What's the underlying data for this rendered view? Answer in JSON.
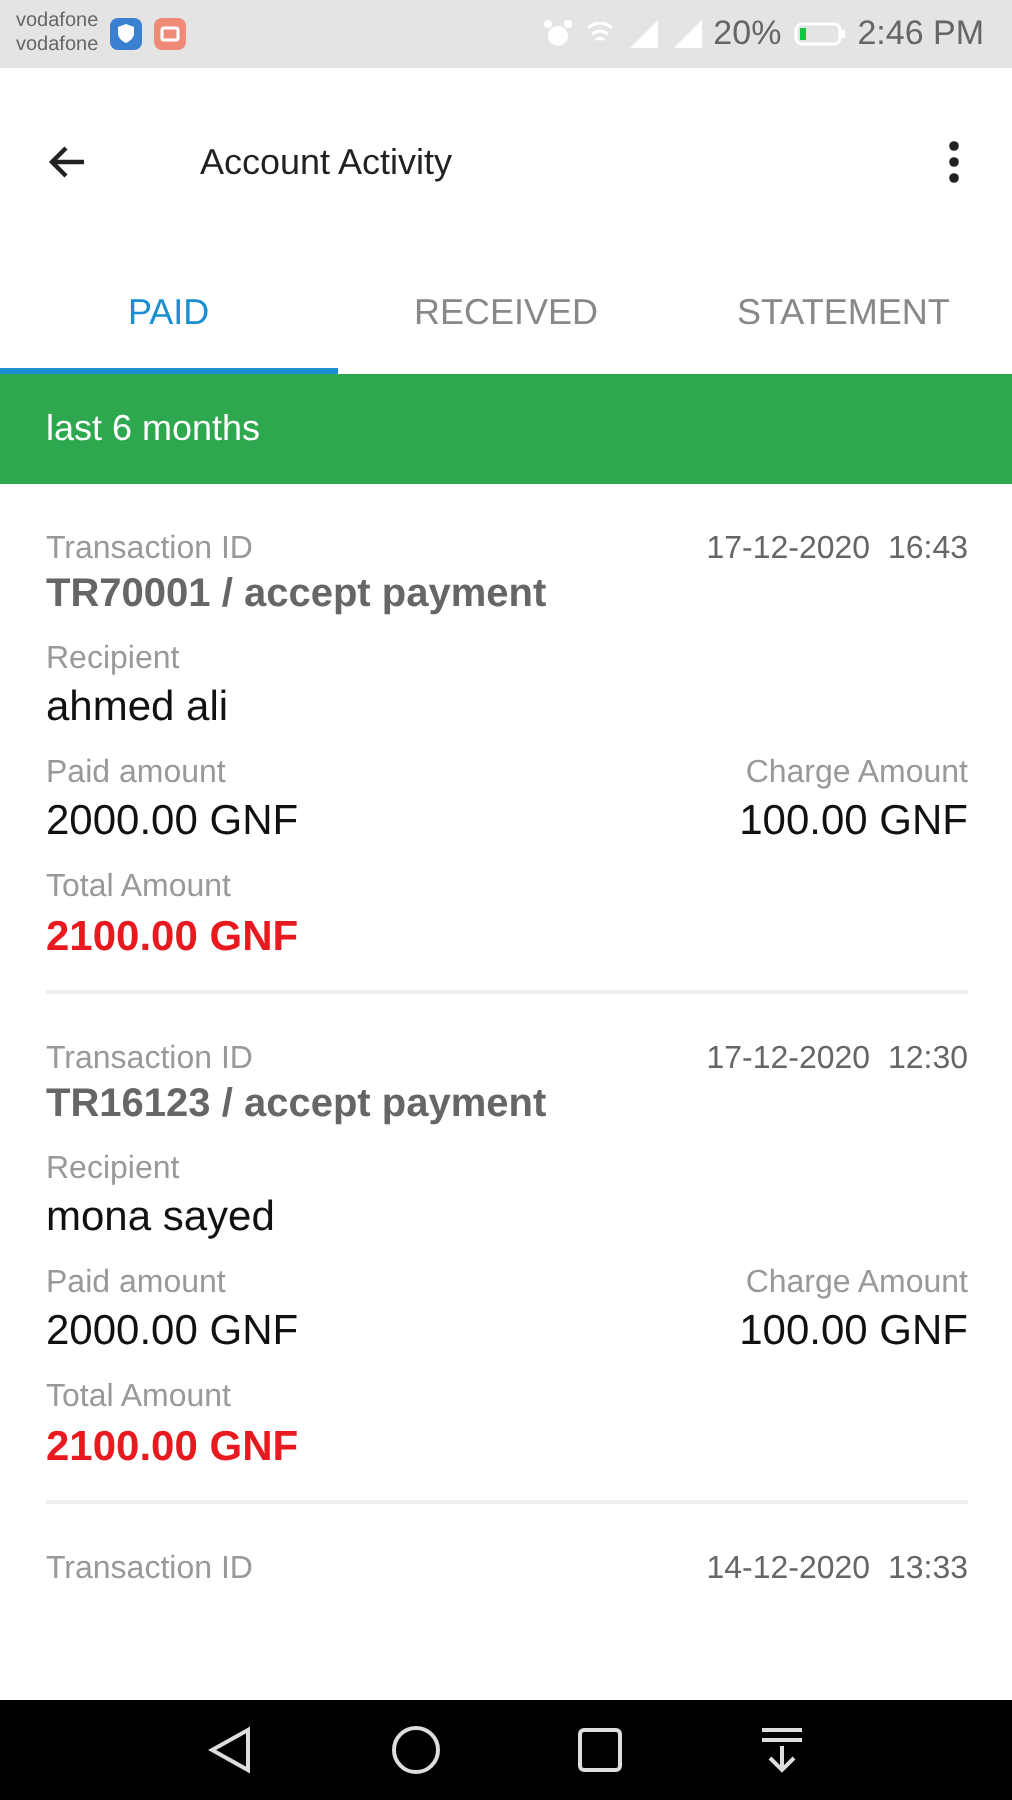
{
  "status_bar": {
    "carriers": [
      "vodafone",
      "vodafone"
    ],
    "battery": "20%",
    "time": "2:46 PM"
  },
  "app_bar": {
    "title": "Account Activity"
  },
  "tabs": [
    {
      "label": "PAID",
      "selected": true
    },
    {
      "label": "RECEIVED",
      "selected": false
    },
    {
      "label": "STATEMENT",
      "selected": false
    }
  ],
  "filter_banner": "last 6 months",
  "transactions": [
    {
      "id_label": "Transaction ID",
      "date": "17-12-2020  16:43",
      "id": "TR70001 / accept payment",
      "recipient_label": "Recipient",
      "recipient": "ahmed ali",
      "paid_label": "Paid amount",
      "paid": "2000.00 GNF",
      "charge_label": "Charge Amount",
      "charge": "100.00 GNF",
      "total_label": "Total Amount",
      "total": "2100.00 GNF"
    },
    {
      "id_label": "Transaction ID",
      "date": "17-12-2020  12:30",
      "id": "TR16123 / accept payment",
      "recipient_label": "Recipient",
      "recipient": "mona sayed",
      "paid_label": "Paid amount",
      "paid": "2000.00 GNF",
      "charge_label": "Charge Amount",
      "charge": "100.00 GNF",
      "total_label": "Total Amount",
      "total": "2100.00 GNF"
    },
    {
      "id_label": "Transaction ID",
      "date": "14-12-2020  13:33"
    }
  ]
}
